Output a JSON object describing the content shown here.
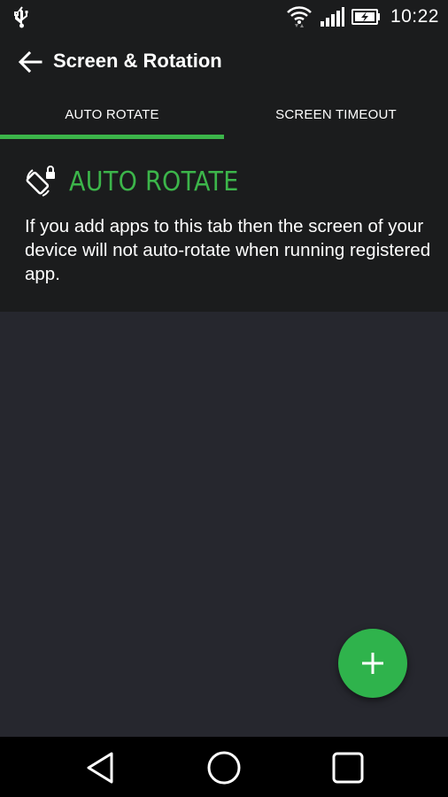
{
  "status_bar": {
    "time": "10:22",
    "icons": [
      "usb-icon",
      "wifi-icon",
      "signal-icon",
      "battery-charging-icon"
    ]
  },
  "app_bar": {
    "title": "Screen & Rotation",
    "back_icon": "arrow-back-icon"
  },
  "tabs": [
    {
      "label": "AUTO ROTATE",
      "selected": true
    },
    {
      "label": "SCREEN TIMEOUT",
      "selected": false
    }
  ],
  "panel": {
    "icon": "rotation-lock-icon",
    "heading": "AUTO ROTATE",
    "description": "If you add apps to this tab then the screen of your device will not auto-rotate when running registered app."
  },
  "fab": {
    "icon": "plus-icon"
  },
  "nav_bar": {
    "icons": [
      "back-triangle-icon",
      "home-circle-icon",
      "recents-square-icon"
    ]
  },
  "colors": {
    "accent": "#3cb54a",
    "fab": "#2fb34c",
    "bar_background": "#1b1c1d",
    "list_background": "#26272e"
  }
}
